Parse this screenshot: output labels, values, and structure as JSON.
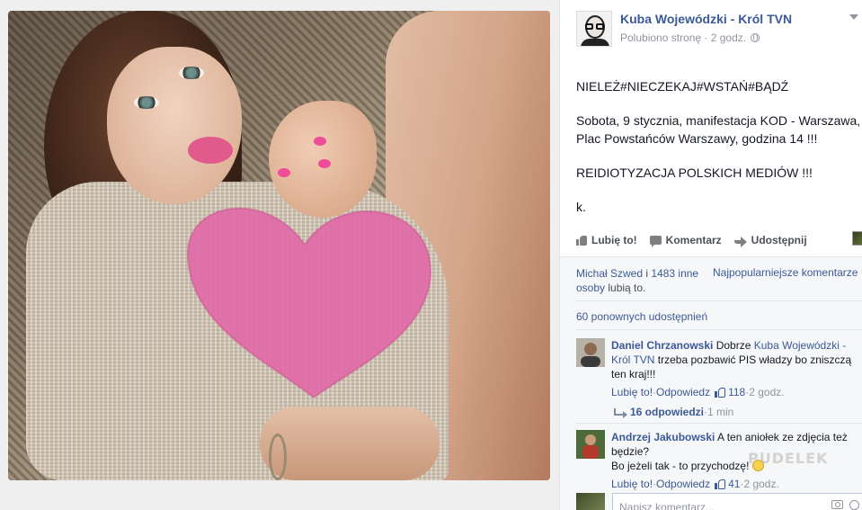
{
  "page": {
    "name": "Kuba Wojewódzki - Król TVN",
    "liked_label": "Polubiono stronę",
    "time": "2 godz."
  },
  "post": {
    "lines": [
      "NIELEŻ#NIECZEKAJ#WSTAŃ#BĄDŹ",
      "Sobota, 9 stycznia, manifestacja KOD - Warszawa,",
      "Plac Powstańców Warszawy, godzina 14 !!!",
      "REIDIOTYZACJA POLSKICH MEDIÓW !!!",
      "k."
    ]
  },
  "actions": {
    "like": "Lubię to!",
    "comment": "Komentarz",
    "share": "Udostępnij"
  },
  "feedback": {
    "liker": "Michał Szwed",
    "conj": " i ",
    "others": "1483 inne osoby",
    "suffix": " lubią to.",
    "top_comments": "Najpopularniejsze komentarze",
    "shares": "60 ponownych udostępnień",
    "accent_color": "#3b5998"
  },
  "comments": [
    {
      "author": "Daniel Chrzanowski",
      "text_pre": " Dobrze ",
      "mention": "Kuba Wojewódzki - Król TVN",
      "text_post": " trzeba pozbawić PIS władzy bo zniszczą ten kraj!!!",
      "like": "Lubię to!",
      "sep": " · ",
      "reply": "Odpowiedz",
      "likes": "118",
      "time": "2 godz.",
      "replies": "16 odpowiedzi",
      "replies_time": "1 min"
    },
    {
      "author": "Andrzej Jakubowski",
      "text_pre": " A ten aniołek ze zdjęcia też będzie?",
      "text_line2": "Bo jeżeli tak - to przychodzę!",
      "emoji": "smile-icon",
      "like": "Lubię to!",
      "sep": " · ",
      "reply": "Odpowiedz",
      "likes": "41",
      "time": "2 godz."
    }
  ],
  "composer": {
    "placeholder": "Napisz komentarz..."
  },
  "watermark": "PUDELEK"
}
